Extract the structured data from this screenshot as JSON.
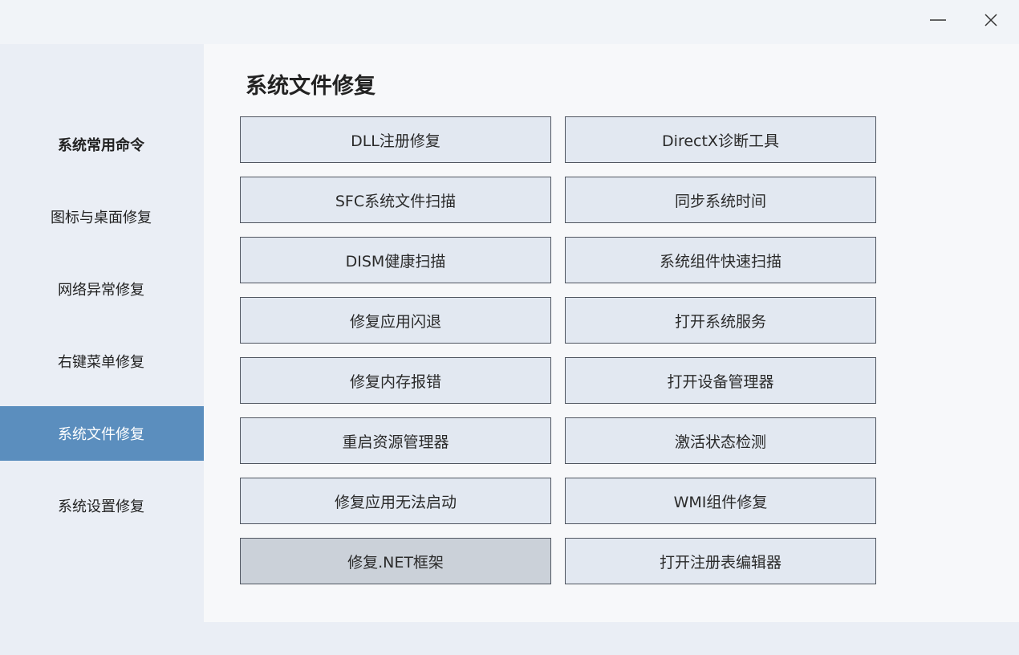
{
  "window": {
    "minimize_icon": "minimize-icon",
    "close_icon": "close-icon"
  },
  "sidebar": {
    "items": [
      {
        "label": "系统常用命令",
        "active": false
      },
      {
        "label": "图标与桌面修复",
        "active": false
      },
      {
        "label": "网络异常修复",
        "active": false
      },
      {
        "label": "右键菜单修复",
        "active": false
      },
      {
        "label": "系统文件修复",
        "active": true
      },
      {
        "label": "系统设置修复",
        "active": false
      }
    ]
  },
  "main": {
    "title": "系统文件修复",
    "buttons": [
      {
        "label": "DLL注册修复"
      },
      {
        "label": "DirectX诊断工具"
      },
      {
        "label": "SFC系统文件扫描"
      },
      {
        "label": "同步系统时间"
      },
      {
        "label": "DISM健康扫描"
      },
      {
        "label": "系统组件快速扫描"
      },
      {
        "label": "修复应用闪退"
      },
      {
        "label": "打开系统服务"
      },
      {
        "label": "修复内存报错"
      },
      {
        "label": "打开设备管理器"
      },
      {
        "label": "重启资源管理器"
      },
      {
        "label": "激活状态检测"
      },
      {
        "label": "修复应用无法启动"
      },
      {
        "label": "WMI组件修复"
      },
      {
        "label": "修复.NET框架"
      },
      {
        "label": "打开注册表编辑器"
      }
    ]
  },
  "colors": {
    "accent": "#5b8ebe",
    "button_bg": "#e2e8f1",
    "button_pressed_bg": "#cbd1d9",
    "button_border": "#505661"
  }
}
